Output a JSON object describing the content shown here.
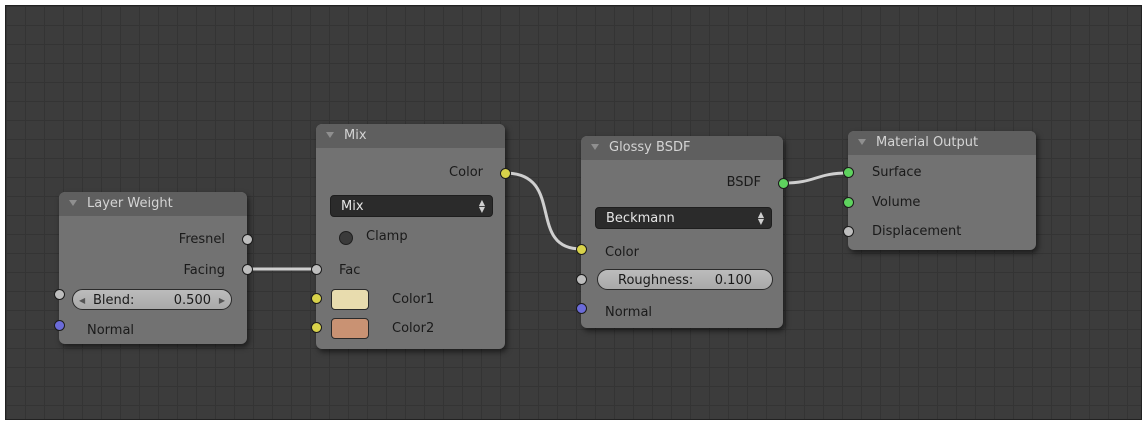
{
  "nodes": {
    "layer_weight": {
      "title": "Layer Weight",
      "outputs": {
        "fresnel": "Fresnel",
        "facing": "Facing"
      },
      "blend": {
        "label": "Blend:",
        "value": "0.500"
      },
      "inputs": {
        "normal": "Normal"
      }
    },
    "mix": {
      "title": "Mix",
      "outputs": {
        "color": "Color"
      },
      "blend_type": "Mix",
      "clamp_label": "Clamp",
      "inputs": {
        "fac": "Fac",
        "color1": "Color1",
        "color2": "Color2"
      },
      "color1_swatch": "#e8dcae",
      "color2_swatch": "#c99273"
    },
    "glossy_bsdf": {
      "title": "Glossy BSDF",
      "outputs": {
        "bsdf": "BSDF"
      },
      "distribution": "Beckmann",
      "inputs": {
        "color": "Color",
        "normal": "Normal"
      },
      "roughness": {
        "label": "Roughness:",
        "value": "0.100"
      }
    },
    "material_output": {
      "title": "Material Output",
      "inputs": {
        "surface": "Surface",
        "volume": "Volume",
        "displacement": "Displacement"
      }
    }
  },
  "socket_colors": {
    "float": "#bdbdbd",
    "color": "#d8d24a",
    "vector": "#6b6bd8",
    "shader": "#5ed35e"
  }
}
